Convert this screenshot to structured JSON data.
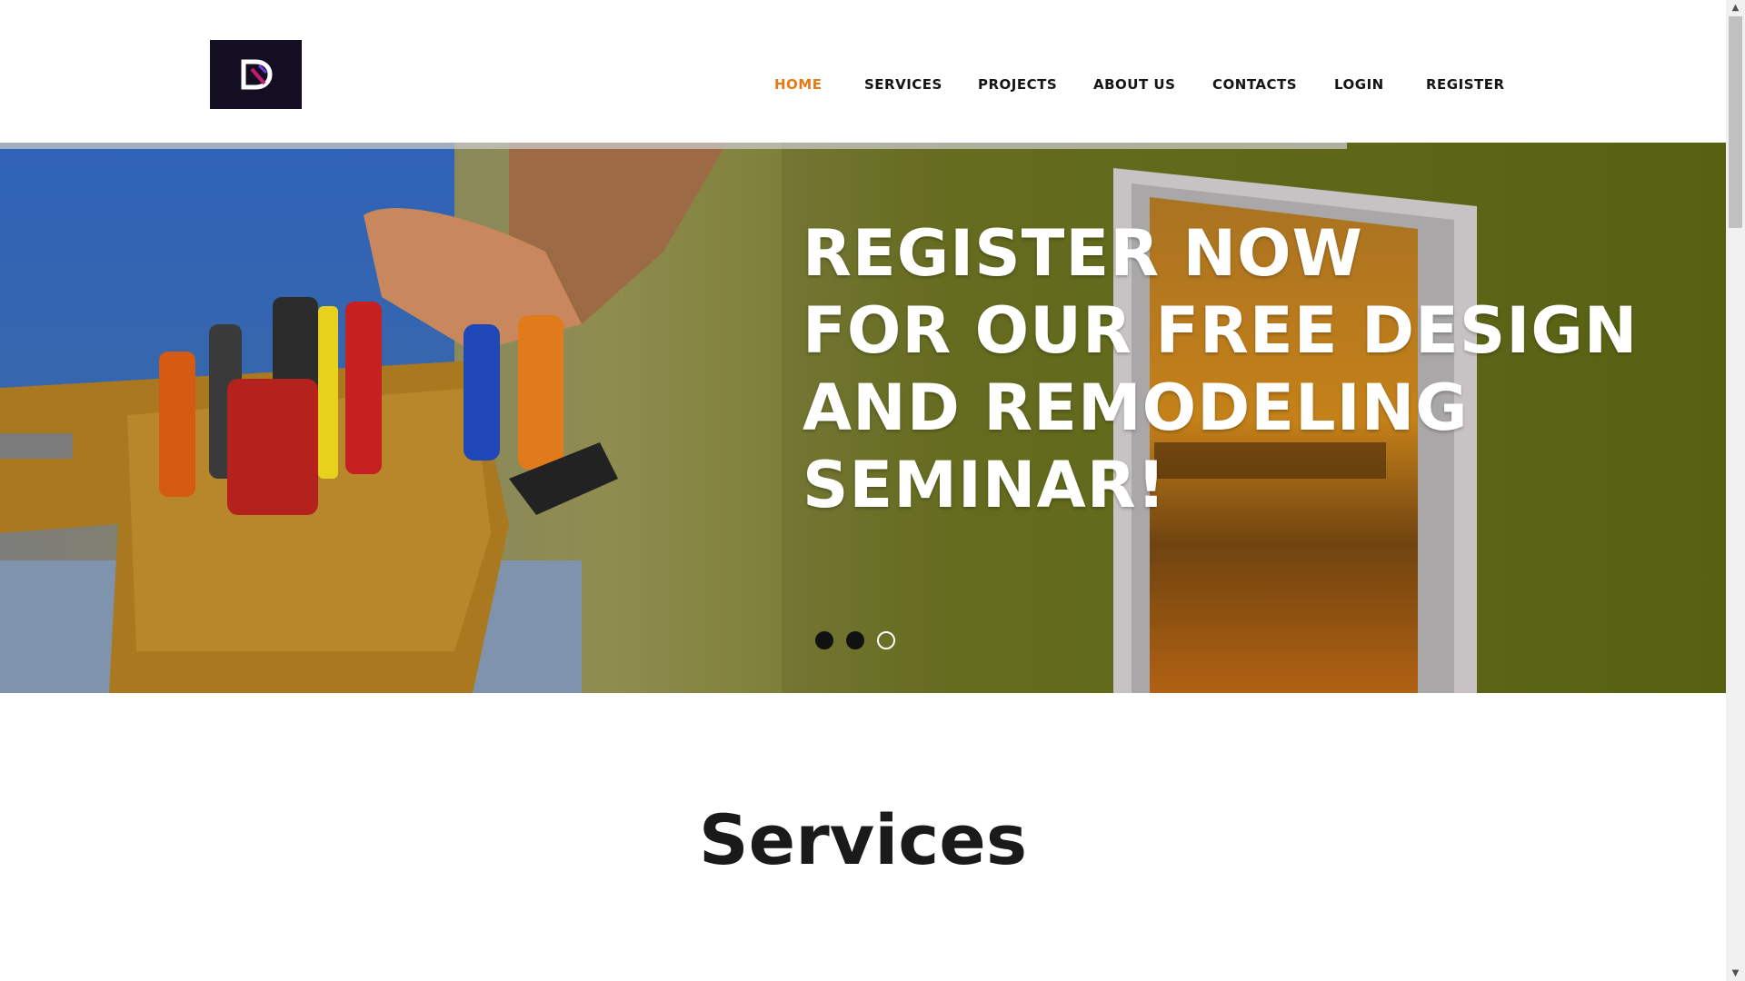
{
  "nav": {
    "items": [
      {
        "label": "HOME",
        "active": true
      },
      {
        "label": "SERVICES",
        "active": false
      },
      {
        "label": "PROJECTS",
        "active": false
      },
      {
        "label": "ABOUT US",
        "active": false
      },
      {
        "label": "CONTACTS",
        "active": false
      },
      {
        "label": "LOGIN",
        "active": false
      },
      {
        "label": "REGISTER",
        "active": false
      }
    ],
    "active_color": "#e57a14"
  },
  "logo": {
    "letter": "D",
    "background": "#140e22"
  },
  "hero": {
    "lines": [
      "REGISTER NOW",
      "FOR OUR FREE DESIGN",
      "AND REMODELING",
      "SEMINAR!"
    ],
    "slides_count": 3,
    "active_slide": 3
  },
  "services": {
    "title": "Services"
  }
}
